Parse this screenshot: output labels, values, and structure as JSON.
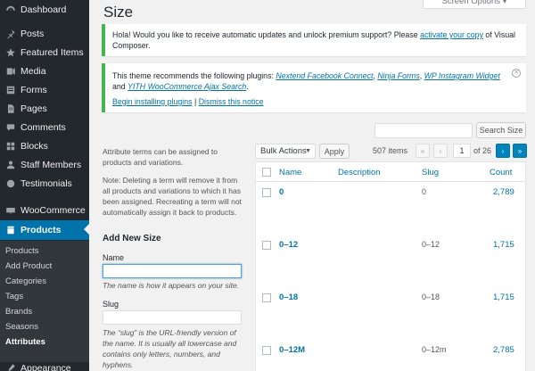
{
  "sidebar": {
    "items": [
      {
        "label": "Dashboard",
        "icon": "dashboard-icon"
      },
      {
        "label": "Posts",
        "icon": "pushpin-icon"
      },
      {
        "label": "Featured Items",
        "icon": "star-icon"
      },
      {
        "label": "Media",
        "icon": "media-icon"
      },
      {
        "label": "Forms",
        "icon": "forms-icon"
      },
      {
        "label": "Pages",
        "icon": "pages-icon"
      },
      {
        "label": "Comments",
        "icon": "comments-icon"
      },
      {
        "label": "Blocks",
        "icon": "blocks-icon"
      },
      {
        "label": "Staff Members",
        "icon": "staff-icon"
      },
      {
        "label": "Testimonials",
        "icon": "testimonials-icon"
      },
      {
        "label": "WooCommerce",
        "icon": "woocommerce-icon"
      },
      {
        "label": "Products",
        "icon": "products-icon"
      },
      {
        "label": "Appearance",
        "icon": "appearance-icon"
      }
    ],
    "submenu": [
      "Products",
      "Add Product",
      "Categories",
      "Tags",
      "Brands",
      "Seasons",
      "Attributes"
    ],
    "current_submenu": "Attributes"
  },
  "header": {
    "title": "Size",
    "screen_options": "Screen Options ▾"
  },
  "notices": {
    "update": {
      "text_before": "Hola! Would you like to receive automatic updates and unlock premium support? Please ",
      "link": "activate your copy",
      "text_after": " of Visual Composer."
    },
    "plugins": {
      "text_before": "This theme recommends the following plugins: ",
      "plugin1": "Nextend Facebook Connect",
      "sep1": ", ",
      "plugin2": "Ninja Forms",
      "sep2": ", ",
      "plugin3": "WP Instagram Widget",
      "and": " and ",
      "plugin4": "YITH WooCommerce Ajax Search",
      "period": ".",
      "begin": "Begin installing plugins",
      "pipe": " | ",
      "dismiss": "Dismiss this notice"
    }
  },
  "search": {
    "button": "Search Size"
  },
  "toolbar": {
    "bulk": "Bulk Actions",
    "apply": "Apply",
    "items": "507 items",
    "first": "«",
    "prev": "‹",
    "page": "1",
    "of": "of 26",
    "next": "›",
    "last": "»"
  },
  "table": {
    "columns": [
      "Name",
      "Description",
      "Slug",
      "Count"
    ],
    "rows": [
      {
        "name": "0",
        "slug": "0",
        "count": "2,789"
      },
      {
        "name": "0–12",
        "slug": "0–12",
        "count": "1,715"
      },
      {
        "name": "0–18",
        "slug": "0–18",
        "count": "1,715"
      },
      {
        "name": "0–12M",
        "slug": "0–12m",
        "count": "2,785"
      }
    ]
  },
  "form": {
    "help1": "Attribute terms can be assigned to products and variations.",
    "help2": "Note: Deleting a term will remove it from all products and variations to which it has been assigned. Recreating a term will not automatically assign it back to products.",
    "title": "Add New Size",
    "name_label": "Name",
    "name_desc": "The name is how it appears on your site.",
    "slug_label": "Slug",
    "slug_desc": "The “slug” is the URL-friendly version of the name. It is usually all lowercase and contains only letters, numbers, and hyphens."
  }
}
